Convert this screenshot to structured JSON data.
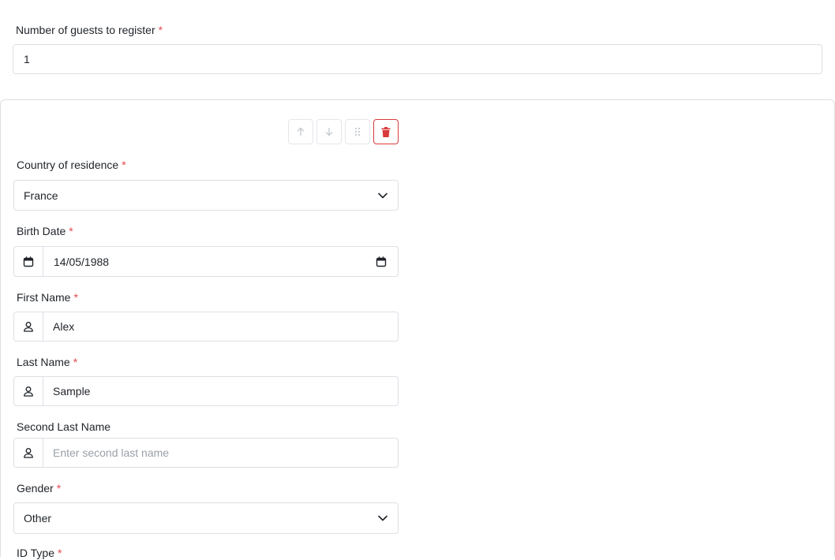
{
  "guests": {
    "label": "Number of guests to register",
    "required_mark": "*",
    "value": "1"
  },
  "guest_card": {
    "toolbar": {
      "move_up_icon": "arrow-up-icon",
      "move_down_icon": "arrow-down-icon",
      "drag_icon": "drag-handle-icon",
      "delete_icon": "trash-icon"
    },
    "country": {
      "label": "Country of residence",
      "required_mark": "*",
      "value": "France"
    },
    "birth_date": {
      "label": "Birth Date",
      "required_mark": "*",
      "value": "14/05/1988"
    },
    "first_name": {
      "label": "First Name",
      "required_mark": "*",
      "value": "Alex"
    },
    "last_name": {
      "label": "Last Name",
      "required_mark": "*",
      "value": "Sample"
    },
    "second_last_name": {
      "label": "Second Last Name",
      "placeholder": "Enter second last name",
      "value": ""
    },
    "gender": {
      "label": "Gender",
      "required_mark": "*",
      "value": "Other"
    },
    "id_type": {
      "label": "ID Type",
      "required_mark": "*"
    }
  },
  "colors": {
    "required": "#e5484d",
    "danger": "#d93b3b",
    "border": "#dcdfe4"
  }
}
